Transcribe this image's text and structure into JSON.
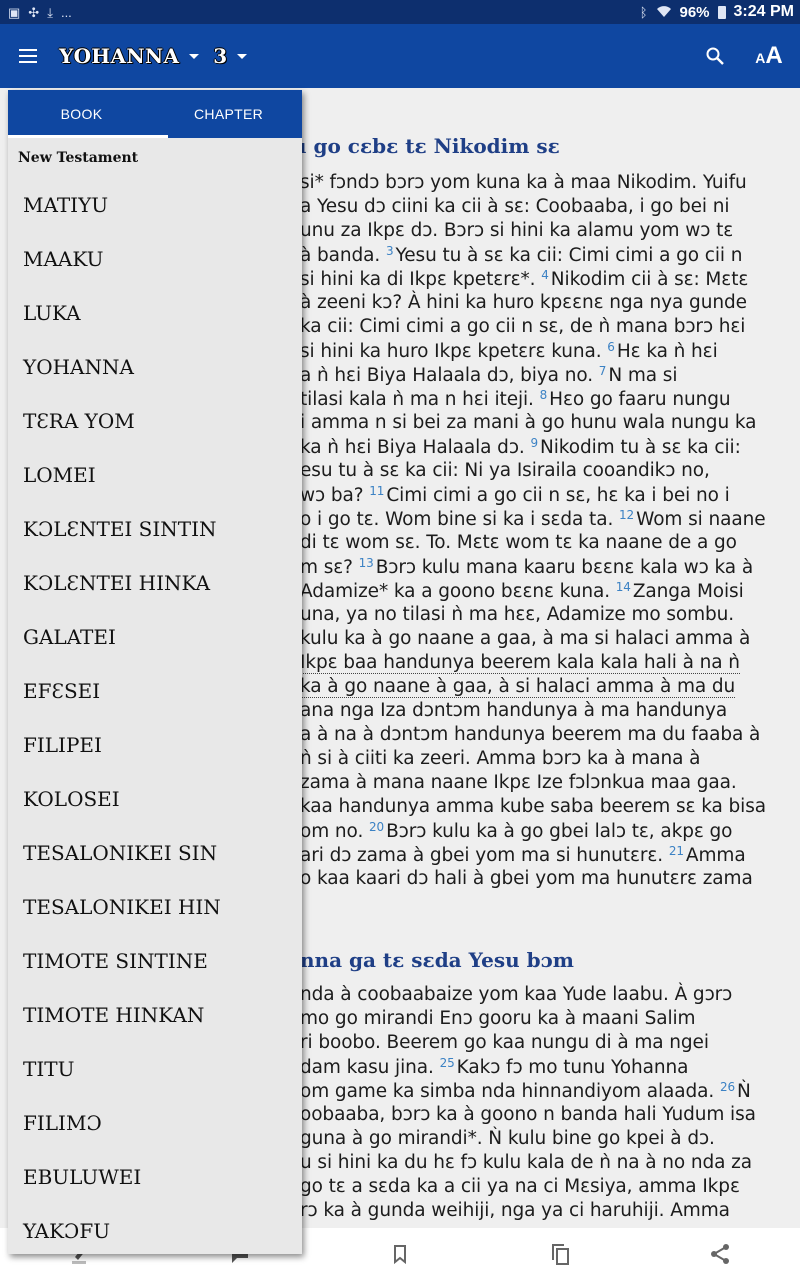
{
  "status_bar": {
    "left_icons": [
      "gallery-icon",
      "pinwheel-icon",
      "download-icon",
      "more-notifications-icon"
    ],
    "more_label": "...",
    "battery_percent": "96%",
    "time": "3:24 PM"
  },
  "app_bar": {
    "book": "YOHANNA",
    "chapter": "3",
    "icons": [
      "menu-icon",
      "search-icon",
      "text-size-icon"
    ]
  },
  "drawer": {
    "tabs": [
      {
        "label": "BOOK",
        "selected": true
      },
      {
        "label": "CHAPTER",
        "selected": false
      }
    ],
    "section": "New Testament",
    "books": [
      "MATIYU",
      "MAAKU",
      "LUKA",
      "YOHANNA",
      "TƐRA YOM",
      "LOMEI",
      "KƆLƐNTEI SINTIN",
      "KƆLƐNTEI HINKA",
      "GALATEI",
      "EFƐSEI",
      "FILIPEI",
      "KOLOSEI",
      "TESALONIKEI SIN",
      "TESALONIKEI HIN",
      "TIMOTE SINTINE",
      "TIMOTE HINKAN",
      "TITU",
      "FILIMƆ",
      "EBULUWEI",
      "YAKƆFU"
    ]
  },
  "reader": {
    "headings": [
      "u go cɛbɛ tɛ Nikodim sɛ",
      "nna ga tɛ sɛda Yesu bɔm"
    ],
    "lines": [
      {
        "pre": "si* fɔndɔ bɔrɔ yom kuna ka à maa Nikodim. Yuifu"
      },
      {
        "pre": "a Yesu dɔ ciini ka cii à sɛ: Coobaaba, i go bei ni"
      },
      {
        "pre": "unu za Ikpɛ dɔ. Bɔrɔ si hini ka alamu yom wɔ tɛ"
      },
      {
        "pre": "à banda. ",
        "verse": "3",
        "post": "Yesu tu à sɛ ka cii: Cimi cimi a go cii n"
      },
      {
        "pre": "si hini ka di Ikpɛ kpetɛrɛ*. ",
        "verse": "4",
        "post": "Nikodim cii à sɛ: Mɛtɛ"
      },
      {
        "pre": "à zeeni kɔ? À hini ka huro kpɛɛnɛ nga nya gunde"
      },
      {
        "pre": "ka cii: Cimi cimi a go cii n sɛ, de ǹ mana bɔrɔ hɛi"
      },
      {
        "pre": "si hini ka huro Ikpɛ kpetɛrɛ kuna. ",
        "verse": "6",
        "post": "Hɛ ka ǹ hɛi"
      },
      {
        "pre": "a ǹ hɛi Biya Halaala dɔ, biya no. ",
        "verse": "7",
        "post": "N ma si"
      },
      {
        "pre": "tilasi kala ǹ ma n hɛi iteji. ",
        "verse": "8",
        "post": "Hɛo go faaru nungu"
      },
      {
        "pre": "i amma n si bei za mani à go hunu wala nungu ka"
      },
      {
        "pre": "ka ǹ hɛi Biya Halaala dɔ. ",
        "verse": "9",
        "post": "Nikodim tu à sɛ ka cii:"
      },
      {
        "pre": "esu tu à sɛ ka cii: Ni ya Isiraila cooandikɔ no,"
      },
      {
        "pre": "wɔ ba? ",
        "verse": "11",
        "post": "Cimi cimi a go cii n sɛ, hɛ ka i bei no i"
      },
      {
        "pre": "o i go tɛ. Wom bine si ka i sɛda ta. ",
        "verse": "12",
        "post": "Wom si naane"
      },
      {
        "pre": "di tɛ wom sɛ. To. Mɛtɛ wom tɛ ka naane de a go"
      },
      {
        "pre": "m sɛ? ",
        "verse": "13",
        "post": "Bɔrɔ kulu mana kaaru bɛɛnɛ kala wɔ ka à"
      },
      {
        "pre": "Adamize* ka a goono bɛɛnɛ kuna. ",
        "verse": "14",
        "post": "Zanga Moisi"
      },
      {
        "pre": "una, ya no tilasi ǹ ma hɛɛ, Adamize mo sombu."
      },
      {
        "pre": "kulu ka à go naane a gaa, à ma si halaci amma à"
      },
      {
        "pre": "Ikpɛ baa handunya beerem kala kala hali à na ǹ",
        "dotted": true
      },
      {
        "pre": "ka à go naane à gaa, à si halaci amma à ma du",
        "dotted": true
      },
      {
        "pre": "ana nga Iza dɔntɔm handunya à ma handunya"
      },
      {
        "pre": "a à na à dɔntɔm handunya beerem ma du faaba à"
      },
      {
        "pre": "ǹ si à ciiti ka zeeri. Amma bɔrɔ ka à mana à"
      },
      {
        "pre": "zama à mana naane Ikpɛ Ize fɔlɔnkua maa gaa."
      },
      {
        "pre": "kaa handunya amma kube saba beerem sɛ ka bisa"
      },
      {
        "pre": "om no. ",
        "verse": "20",
        "post": "Bɔrɔ kulu ka à go gbei lalɔ tɛ, akpɛ go"
      },
      {
        "pre": "ari dɔ zama à gbei yom ma si hunutɛrɛ. ",
        "verse": "21",
        "post": "Amma"
      },
      {
        "pre": "o kaa kaari dɔ hali à gbei yom ma hunutɛrɛ zama"
      },
      {
        "pre": "nda à coobaabaize yom kaa Yude laabu. À gɔrɔ"
      },
      {
        "pre": "mo go mirandi Enɔ gooru ka à maani Salim"
      },
      {
        "pre": "ri boobo. Beerem go kaa nungu di à ma ngei"
      },
      {
        "pre": "dam kasu jina. ",
        "verse": "25",
        "post": "Kakɔ fɔ mo tunu Yohanna"
      },
      {
        "pre": "om game ka simba nda hinnandiyom alaada. ",
        "verse": "26",
        "post": "Ǹ"
      },
      {
        "pre": "oobaaba, bɔrɔ ka à goono n banda hali Yudum isa"
      },
      {
        "pre": "guna à go mirandi*. Ǹ kulu bine go kpei à dɔ."
      },
      {
        "pre": "u si hini ka du hɛ fɔ kulu kala de ǹ na à no nda za"
      },
      {
        "pre": "go tɛ a sɛda ka a cii ya na ci Mɛsiya, amma Ikpɛ"
      },
      {
        "pre": "rɔ ka à gunda weihiji, nga ya ci haruhiji. Amma"
      }
    ]
  },
  "bottom_bar": {
    "icons": [
      "highlight-icon",
      "note-icon",
      "bookmark-icon",
      "copy-icon",
      "share-icon"
    ]
  },
  "colors": {
    "app_bar": "#0f47a1",
    "status_bar": "#0d2f6e",
    "heading": "#1f3f86",
    "verse_number": "#3c82c4",
    "drawer_bg": "#e8e8e8"
  }
}
